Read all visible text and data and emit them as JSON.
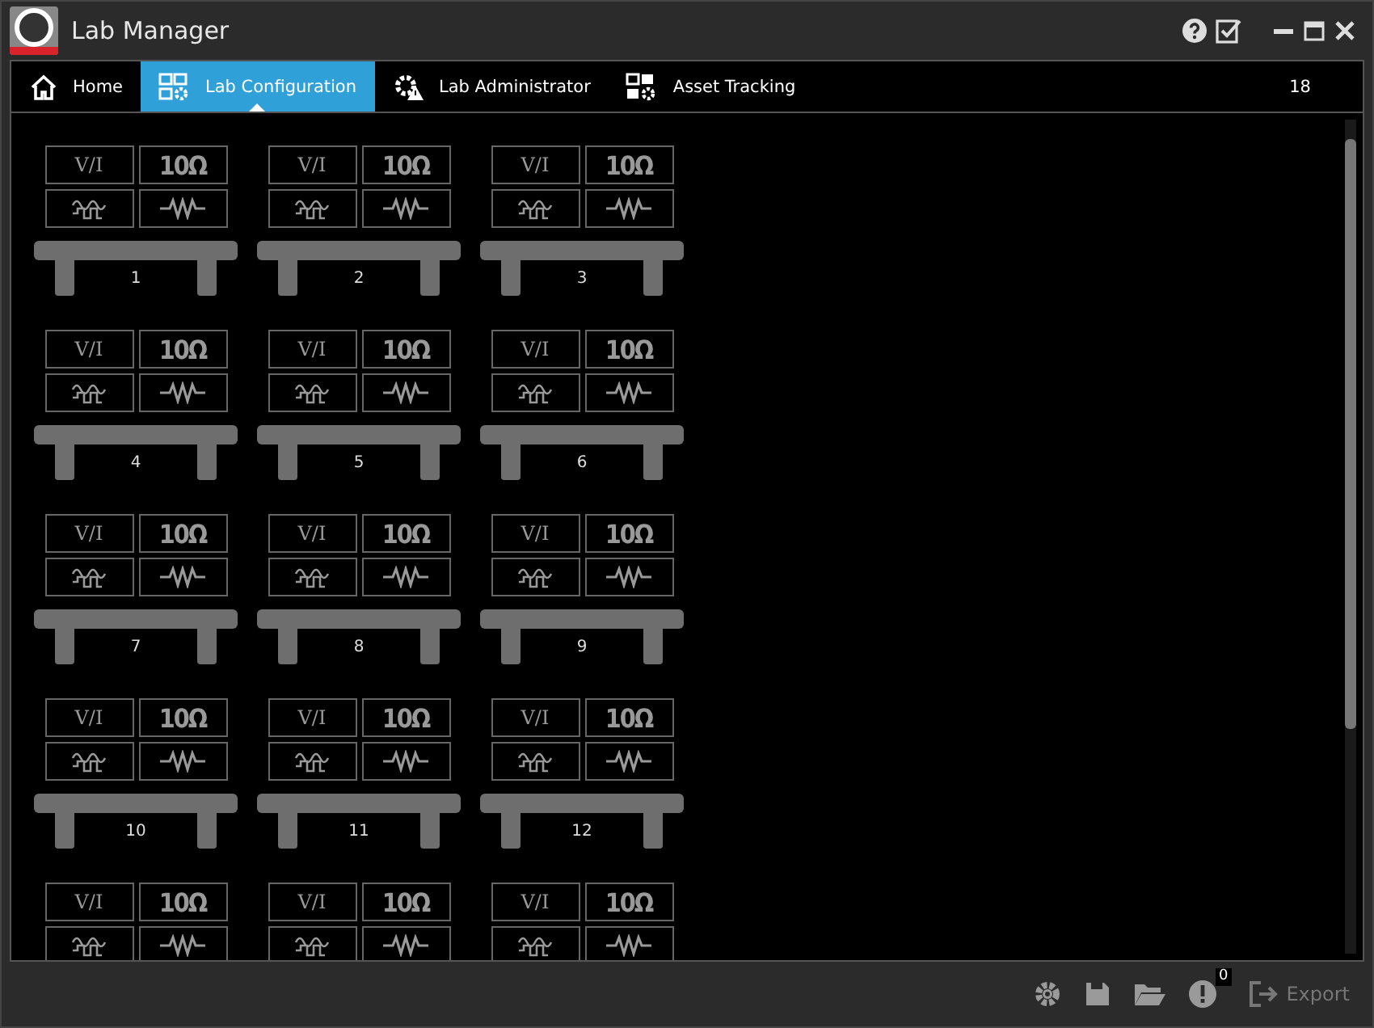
{
  "window": {
    "title": "Lab Manager"
  },
  "tabs": [
    {
      "label": "Home",
      "selected": false
    },
    {
      "label": "Lab Configuration",
      "selected": true
    },
    {
      "label": "Lab Administrator",
      "selected": false
    },
    {
      "label": "Asset Tracking",
      "selected": false
    }
  ],
  "tab_count": "18",
  "benches": [
    {
      "vi_label": "V/I",
      "ohm_label": "10Ω",
      "number": "1"
    },
    {
      "vi_label": "V/I",
      "ohm_label": "10Ω",
      "number": "2"
    },
    {
      "vi_label": "V/I",
      "ohm_label": "10Ω",
      "number": "3"
    },
    {
      "vi_label": "V/I",
      "ohm_label": "10Ω",
      "number": "4"
    },
    {
      "vi_label": "V/I",
      "ohm_label": "10Ω",
      "number": "5"
    },
    {
      "vi_label": "V/I",
      "ohm_label": "10Ω",
      "number": "6"
    },
    {
      "vi_label": "V/I",
      "ohm_label": "10Ω",
      "number": "7"
    },
    {
      "vi_label": "V/I",
      "ohm_label": "10Ω",
      "number": "8"
    },
    {
      "vi_label": "V/I",
      "ohm_label": "10Ω",
      "number": "9"
    },
    {
      "vi_label": "V/I",
      "ohm_label": "10Ω",
      "number": "10"
    },
    {
      "vi_label": "V/I",
      "ohm_label": "10Ω",
      "number": "11"
    },
    {
      "vi_label": "V/I",
      "ohm_label": "10Ω",
      "number": "12"
    },
    {
      "vi_label": "V/I",
      "ohm_label": "10Ω"
    },
    {
      "vi_label": "V/I",
      "ohm_label": "10Ω"
    },
    {
      "vi_label": "V/I",
      "ohm_label": "10Ω"
    }
  ],
  "footer": {
    "alert_count": "0",
    "export": {
      "label": "Export",
      "disabled": true
    }
  }
}
